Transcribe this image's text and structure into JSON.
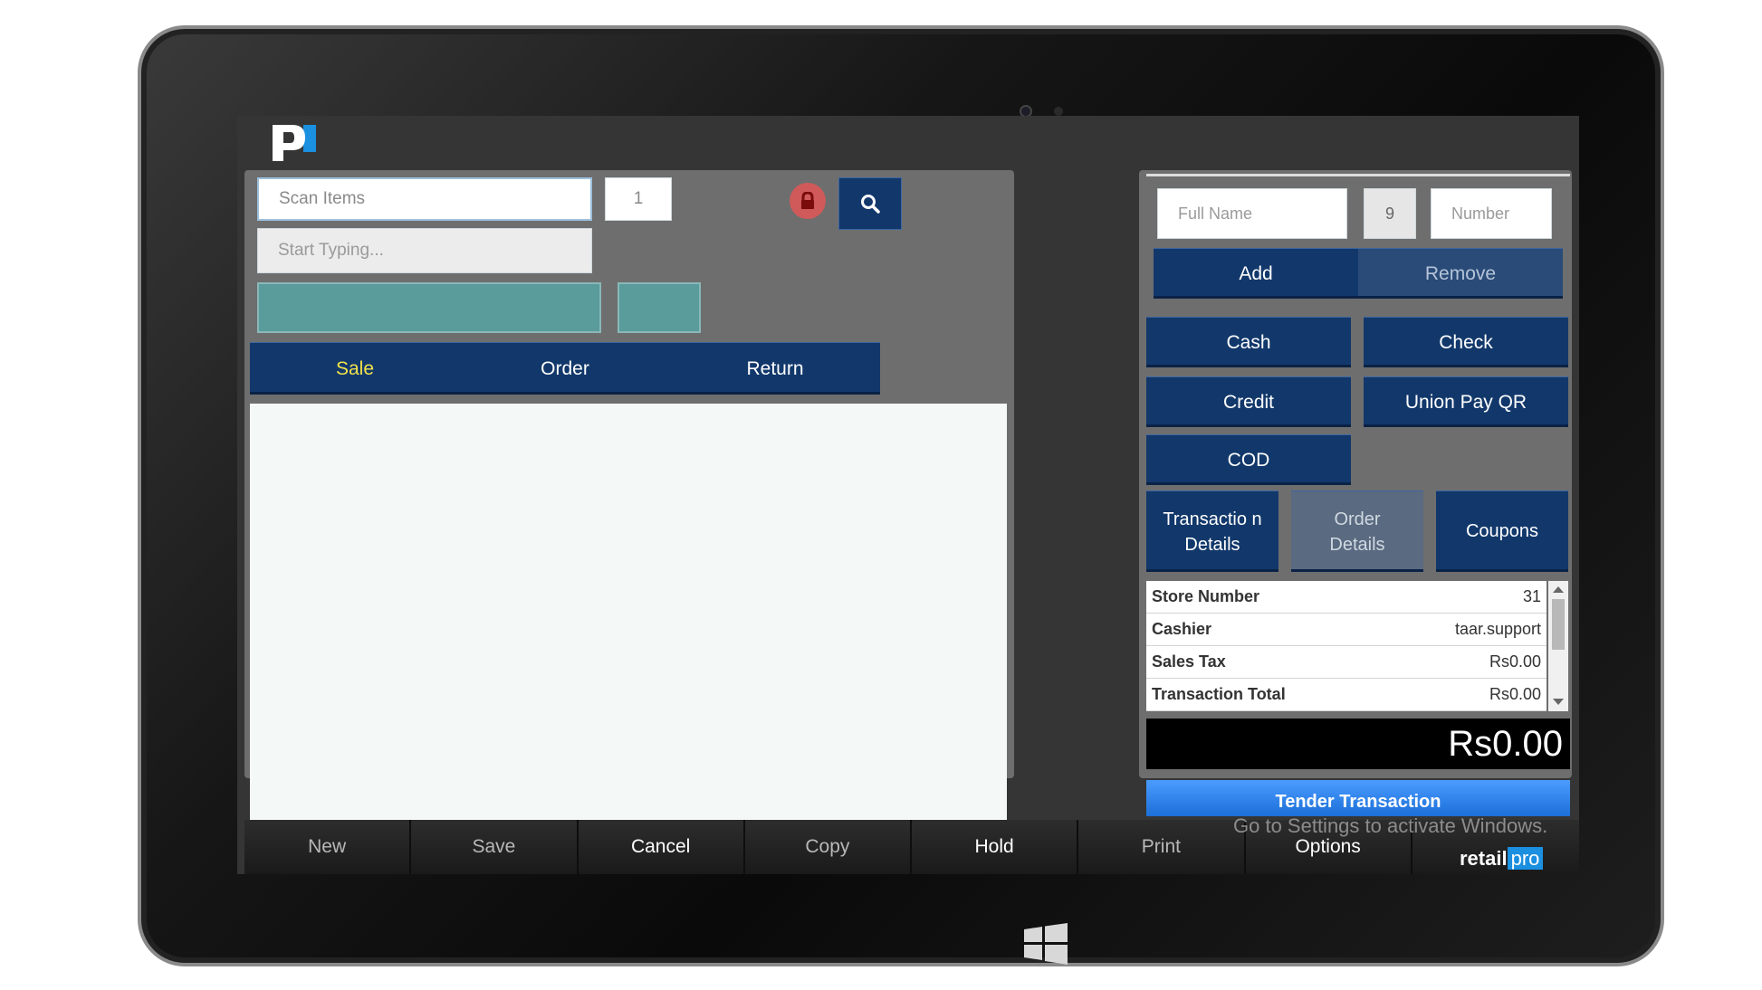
{
  "colors": {
    "primary_button": "#12386b",
    "teal": "#5a9b9b",
    "sale_highlight": "#f2e24a",
    "tender": "#1c6fd8"
  },
  "icons": {
    "brand": "retailpro-p-logo",
    "lock": "lock-icon",
    "search": "search-icon",
    "windows": "windows-logo-icon"
  },
  "scan": {
    "placeholder": "Scan Items",
    "qty": "1",
    "typing_placeholder": "Start Typing..."
  },
  "tabs": {
    "sale": "Sale",
    "order": "Order",
    "return": "Return"
  },
  "customer": {
    "full_name": "Full Name",
    "code": "9",
    "number": "Number",
    "add": "Add",
    "remove": "Remove"
  },
  "payments": {
    "cash": "Cash",
    "check": "Check",
    "credit": "Credit",
    "union_pay": "Union Pay QR",
    "cod": "COD"
  },
  "details": {
    "transaction": "Transactio n Details",
    "order": "Order Details",
    "coupons": "Coupons"
  },
  "info": [
    {
      "label": "Store Number",
      "value": "31"
    },
    {
      "label": "Cashier",
      "value": "taar.support"
    },
    {
      "label": "Sales Tax",
      "value": "Rs0.00"
    },
    {
      "label": "Transaction Total",
      "value": "Rs0.00"
    }
  ],
  "total": "Rs0.00",
  "tender": "Tender Transaction",
  "bottom": {
    "new": "New",
    "save": "Save",
    "cancel": "Cancel",
    "copy": "Copy",
    "hold": "Hold",
    "print": "Print",
    "options": "Options"
  },
  "retail_logo": {
    "a": "retail",
    "b": "pro"
  },
  "watermark": "Go to Settings to activate Windows."
}
